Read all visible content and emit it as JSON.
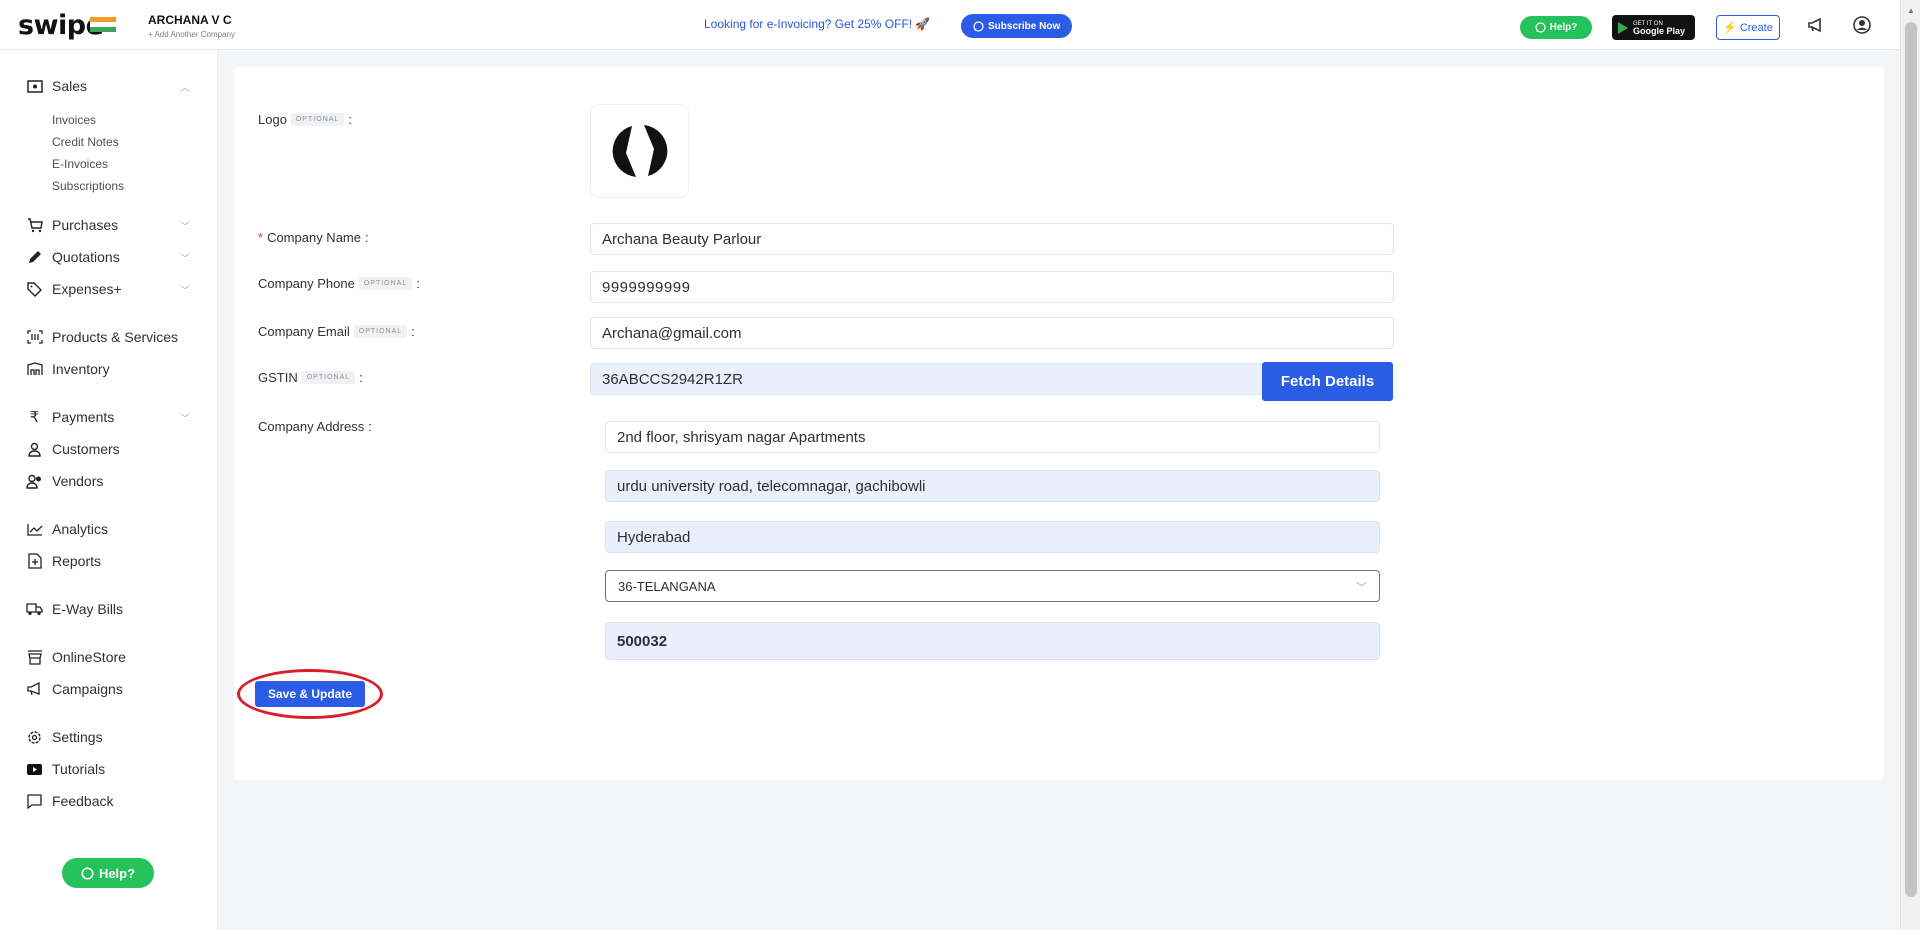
{
  "header": {
    "logo_text": "swipe",
    "company_name": "ARCHANA V C",
    "add_company": "+ Add Another Company",
    "promo_text": "Looking for e-Invoicing? Get 25% OFF! 🚀",
    "subscribe_label": "Subscribe Now",
    "help_label": "Help?",
    "gplay_small": "GET IT ON",
    "gplay_big": "Google Play",
    "create_label": "Create",
    "icons": [
      "whatsapp-icon",
      "megaphone-icon",
      "account-icon"
    ]
  },
  "sidebar": {
    "sales_label": "Sales",
    "sales_sub": [
      "Invoices",
      "Credit Notes",
      "E-Invoices",
      "Subscriptions"
    ],
    "items": [
      {
        "label": "Purchases",
        "icon": "cart-icon"
      },
      {
        "label": "Quotations",
        "icon": "pencil-icon"
      },
      {
        "label": "Expenses+",
        "icon": "tag-icon"
      },
      {
        "label": "Products & Services",
        "icon": "barcode-icon"
      },
      {
        "label": "Inventory",
        "icon": "warehouse-icon"
      },
      {
        "label": "Payments",
        "icon": "rupee-icon"
      },
      {
        "label": "Customers",
        "icon": "user-icon"
      },
      {
        "label": "Vendors",
        "icon": "users-icon"
      },
      {
        "label": "Analytics",
        "icon": "chart-icon"
      },
      {
        "label": "Reports",
        "icon": "report-icon"
      },
      {
        "label": "E-Way Bills",
        "icon": "truck-icon"
      },
      {
        "label": "OnlineStore",
        "icon": "store-icon"
      },
      {
        "label": "Campaigns",
        "icon": "megaphone-icon"
      },
      {
        "label": "Settings",
        "icon": "gear-icon"
      },
      {
        "label": "Tutorials",
        "icon": "youtube-icon"
      },
      {
        "label": "Feedback",
        "icon": "comment-icon"
      }
    ],
    "help_label": "Help?"
  },
  "form": {
    "optional_tag": "OPTIONAL",
    "logo_label": "Logo",
    "company_name_label": "Company Name",
    "company_name_value": "Archana Beauty Parlour",
    "phone_label": "Company Phone",
    "phone_value": "9999999999",
    "email_label": "Company Email",
    "email_value": "Archana@gmail.com",
    "gstin_label": "GSTIN",
    "gstin_value": "36ABCCS2942R1ZR",
    "fetch_label": "Fetch Details",
    "address_label": "Company Address",
    "address_line1": "2nd floor, shrisyam nagar Apartments",
    "address_line2": "urdu university road, telecomnagar, gachibowli",
    "city": "Hyderabad",
    "state": "36-TELANGANA",
    "pincode": "500032",
    "save_label": "Save & Update"
  },
  "colors": {
    "accent": "#2a5ce6",
    "whatsapp": "#25c25b",
    "highlight_ring": "#d81f26"
  }
}
